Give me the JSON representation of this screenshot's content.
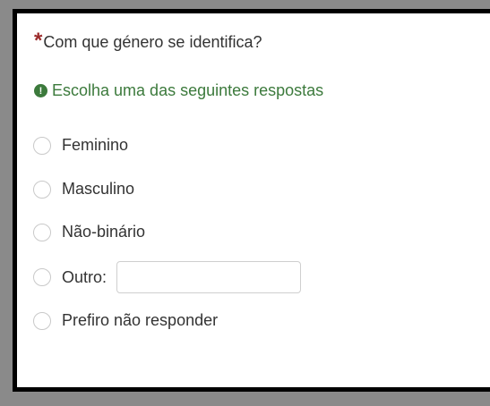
{
  "question": {
    "required_marker": "*",
    "text": "Com que género se identifica?"
  },
  "help": {
    "icon": "exclamation-circle-icon",
    "text": "Escolha uma das seguintes respostas",
    "color": "#3c7a3c"
  },
  "options": [
    {
      "label": "Feminino"
    },
    {
      "label": "Masculino"
    },
    {
      "label": "Não-binário"
    },
    {
      "label": "Outro:",
      "other_value": ""
    },
    {
      "label": "Prefiro não responder"
    }
  ]
}
